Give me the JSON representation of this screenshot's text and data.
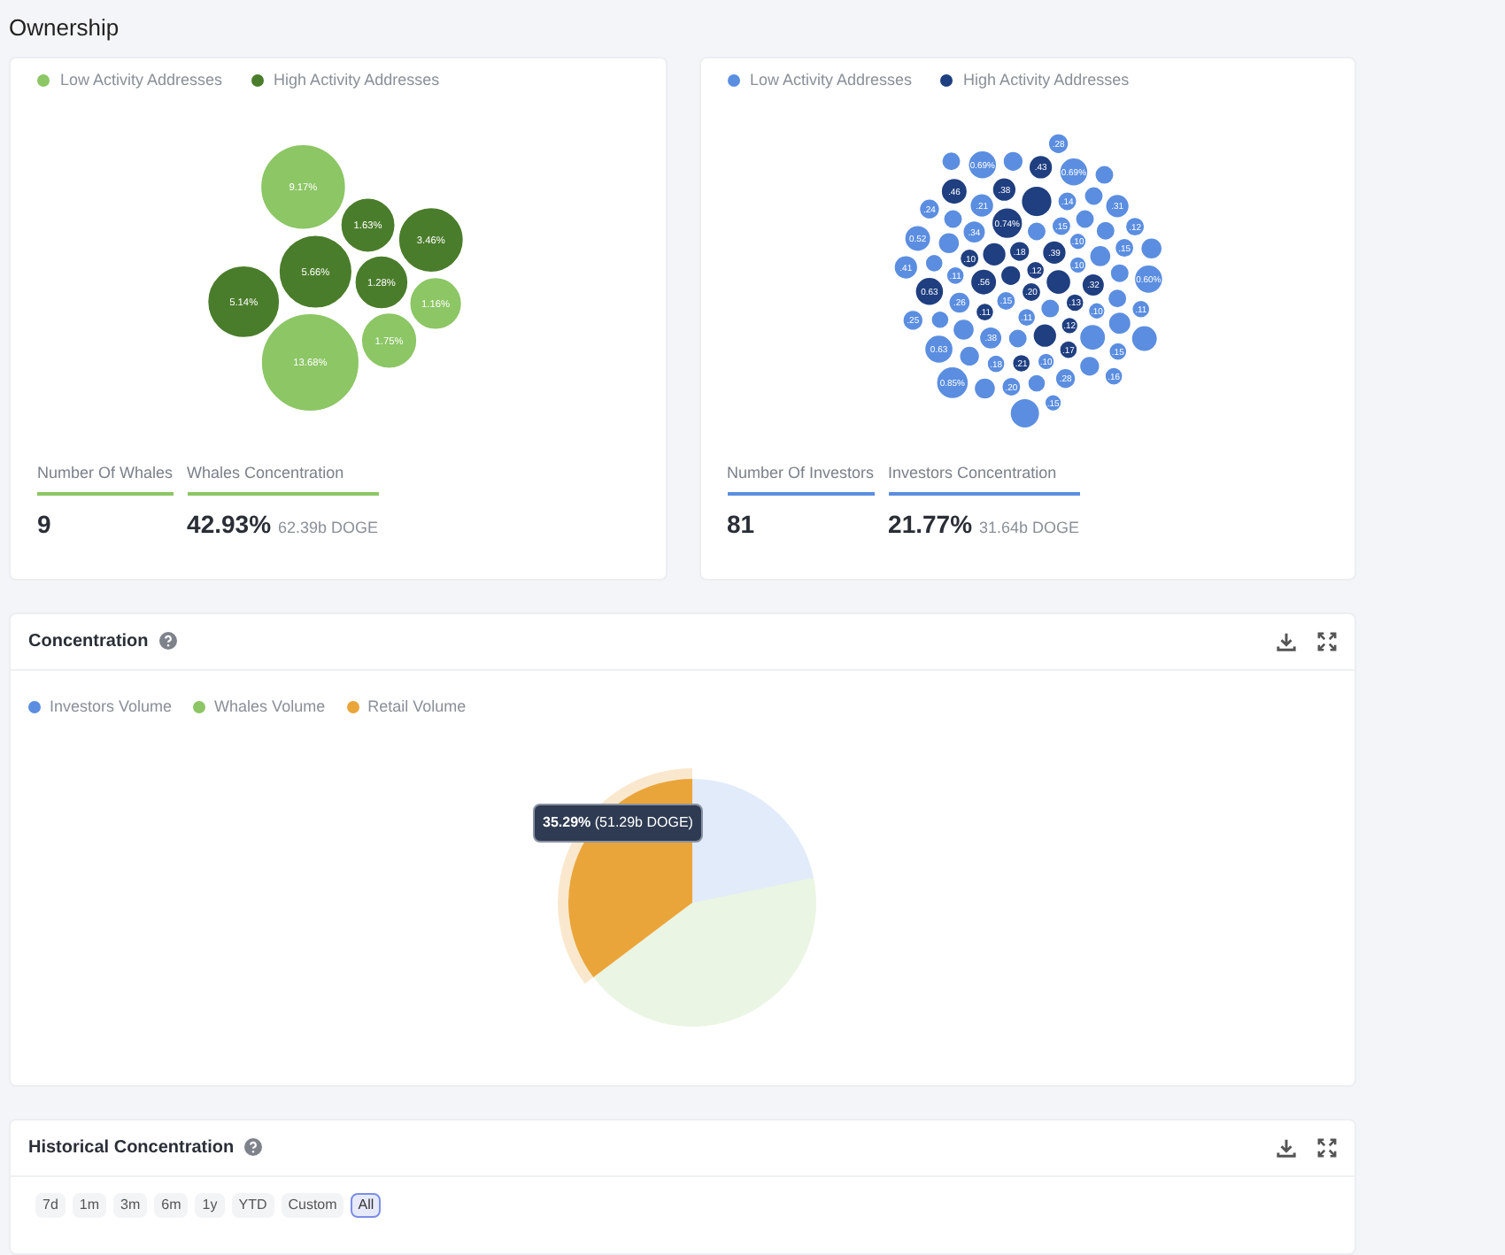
{
  "page_title": "Ownership",
  "whales": {
    "legend": [
      {
        "label": "Low Activity Addresses",
        "kind": "low",
        "color": "#8cc665"
      },
      {
        "label": "High Activity Addresses",
        "kind": "high",
        "color": "#4a7d2b"
      }
    ],
    "bubbles": [
      {
        "label": "9.17%",
        "kind": "low"
      },
      {
        "label": "1.63%",
        "kind": "high"
      },
      {
        "label": "3.46%",
        "kind": "high"
      },
      {
        "label": "5.66%",
        "kind": "high"
      },
      {
        "label": "1.28%",
        "kind": "high"
      },
      {
        "label": "5.14%",
        "kind": "high"
      },
      {
        "label": "1.16%",
        "kind": "low"
      },
      {
        "label": "1.75%",
        "kind": "low"
      },
      {
        "label": "13.68%",
        "kind": "low"
      }
    ],
    "stats": [
      {
        "label": "Number Of Whales",
        "value": "9"
      },
      {
        "label": "Whales Concentration",
        "value": "42.93%",
        "sub": "62.39b DOGE"
      }
    ]
  },
  "investors": {
    "legend": [
      {
        "label": "Low Activity Addresses",
        "kind": "low",
        "color": "#5b8ee0"
      },
      {
        "label": "High Activity Addresses",
        "kind": "high",
        "color": "#1f3f80"
      }
    ],
    "bubbles": [
      {
        "label": ".28",
        "kind": "low"
      },
      {
        "kind": "low"
      },
      {
        "label": "0.69%",
        "kind": "low"
      },
      {
        "kind": "low"
      },
      {
        "label": ".43",
        "kind": "high"
      },
      {
        "label": "0.69%",
        "kind": "low"
      },
      {
        "kind": "low"
      },
      {
        "label": ".46",
        "kind": "high"
      },
      {
        "label": ".38",
        "kind": "high"
      },
      {
        "kind": "high"
      },
      {
        "label": ".14",
        "kind": "low"
      },
      {
        "kind": "low"
      },
      {
        "label": ".31",
        "kind": "low"
      },
      {
        "label": ".24",
        "kind": "low"
      },
      {
        "label": ".21",
        "kind": "low"
      },
      {
        "kind": "low"
      },
      {
        "label": "0.74%",
        "kind": "high"
      },
      {
        "kind": "low"
      },
      {
        "label": ".15",
        "kind": "low"
      },
      {
        "kind": "low"
      },
      {
        "label": ".34",
        "kind": "low"
      },
      {
        "label": "0.52",
        "kind": "low"
      },
      {
        "kind": "low"
      },
      {
        "kind": "low"
      },
      {
        "label": ".12",
        "kind": "low"
      },
      {
        "label": ".18",
        "kind": "high"
      },
      {
        "kind": "high"
      },
      {
        "label": ".39",
        "kind": "high"
      },
      {
        "label": ".10",
        "kind": "low"
      },
      {
        "label": ".15",
        "kind": "low"
      },
      {
        "kind": "low"
      },
      {
        "label": ".10",
        "kind": "high"
      },
      {
        "label": ".41",
        "kind": "low"
      },
      {
        "kind": "low"
      },
      {
        "label": ".12",
        "kind": "high"
      },
      {
        "label": ".10",
        "kind": "low"
      },
      {
        "kind": "low"
      },
      {
        "label": ".11",
        "kind": "low"
      },
      {
        "kind": "high"
      },
      {
        "label": ".56",
        "kind": "high"
      },
      {
        "kind": "high"
      },
      {
        "label": ".32",
        "kind": "high"
      },
      {
        "kind": "low"
      },
      {
        "label": "0.60%",
        "kind": "low"
      },
      {
        "label": "0.63",
        "kind": "high"
      },
      {
        "label": ".20",
        "kind": "high"
      },
      {
        "label": ".26",
        "kind": "low"
      },
      {
        "label": ".15",
        "kind": "low"
      },
      {
        "kind": "low"
      },
      {
        "label": ".13",
        "kind": "high"
      },
      {
        "label": ".11",
        "kind": "high"
      },
      {
        "kind": "low"
      },
      {
        "label": ".11",
        "kind": "low"
      },
      {
        "label": ".25",
        "kind": "low"
      },
      {
        "kind": "low"
      },
      {
        "label": ".11",
        "kind": "low"
      },
      {
        "label": ".10",
        "kind": "low"
      },
      {
        "kind": "low"
      },
      {
        "label": ".12",
        "kind": "high"
      },
      {
        "kind": "low"
      },
      {
        "label": ".38",
        "kind": "low"
      },
      {
        "kind": "low"
      },
      {
        "kind": "high"
      },
      {
        "kind": "low"
      },
      {
        "kind": "low"
      },
      {
        "label": "0.63",
        "kind": "low"
      },
      {
        "kind": "low"
      },
      {
        "label": ".17",
        "kind": "high"
      },
      {
        "label": ".15",
        "kind": "low"
      },
      {
        "label": ".18",
        "kind": "low"
      },
      {
        "label": ".21",
        "kind": "high"
      },
      {
        "label": ".10",
        "kind": "low"
      },
      {
        "kind": "low"
      },
      {
        "label": "0.85%",
        "kind": "low"
      },
      {
        "kind": "low"
      },
      {
        "label": ".20",
        "kind": "low"
      },
      {
        "kind": "low"
      },
      {
        "label": ".28",
        "kind": "low"
      },
      {
        "label": ".16",
        "kind": "low"
      },
      {
        "label": ".15",
        "kind": "low"
      },
      {
        "kind": "low"
      }
    ],
    "stats": [
      {
        "label": "Number Of Investors",
        "value": "81"
      },
      {
        "label": "Investors Concentration",
        "value": "21.77%",
        "sub": "31.64b DOGE"
      }
    ]
  },
  "concentration": {
    "title": "Concentration",
    "legend": [
      {
        "label": "Investors Volume",
        "color": "#5b8ee0",
        "selected": false
      },
      {
        "label": "Whales Volume",
        "color": "#8cc665",
        "selected": false
      },
      {
        "label": "Retail Volume",
        "color": "#eaa53a",
        "selected": true
      }
    ],
    "tooltip": {
      "value": "35.29%",
      "sub": "(51.29b DOGE)"
    },
    "chart_data": {
      "type": "pie",
      "values": [
        21.77,
        42.93,
        35.29
      ]
    }
  },
  "history": {
    "title": "Historical Concentration",
    "ranges": [
      {
        "label": "7d",
        "selected": false
      },
      {
        "label": "1m",
        "selected": false
      },
      {
        "label": "3m",
        "selected": false
      },
      {
        "label": "6m",
        "selected": false
      },
      {
        "label": "1y",
        "selected": false
      },
      {
        "label": "YTD",
        "selected": false
      },
      {
        "label": "Custom",
        "selected": false
      },
      {
        "label": "All",
        "selected": true
      }
    ]
  }
}
